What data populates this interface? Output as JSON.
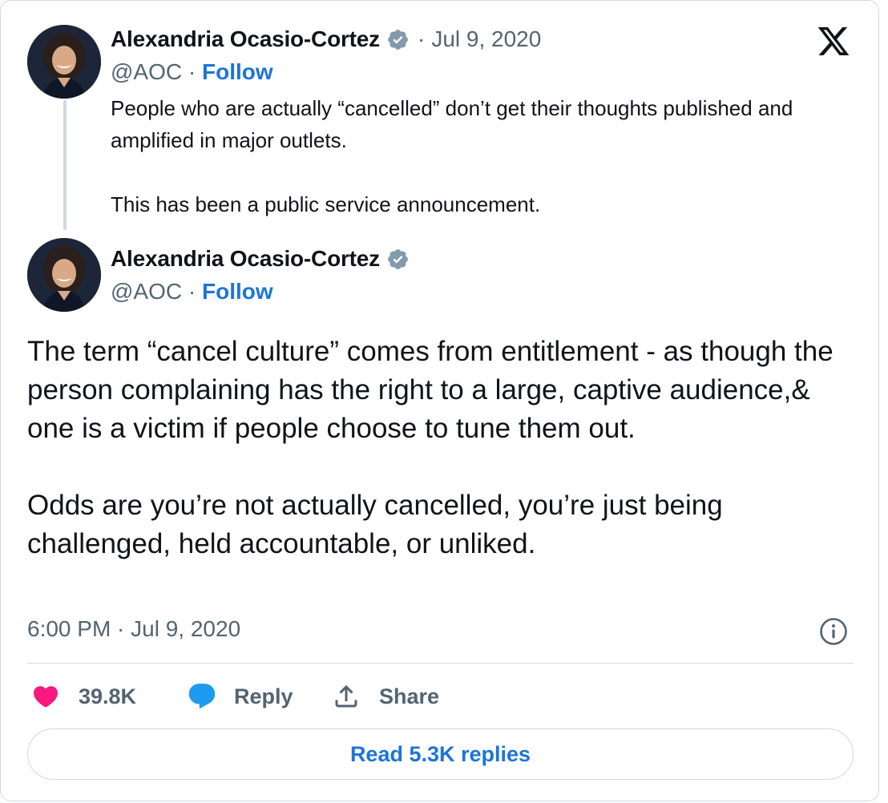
{
  "quoted_tweet": {
    "author_name": "Alexandria Ocasio-Cortez",
    "handle": "@AOC",
    "separator": "·",
    "follow_label": "Follow",
    "date_separator": "·",
    "date": "Jul 9, 2020",
    "text_paragraphs": [
      "People who are actually “cancelled” don’t get their thoughts published and amplified in major outlets.",
      "This has been a public service announcement."
    ]
  },
  "main_tweet": {
    "author_name": "Alexandria Ocasio-Cortez",
    "handle": "@AOC",
    "separator": "·",
    "follow_label": "Follow",
    "text_paragraphs": [
      "The term “cancel culture” comes from entitlement - as though the person complaining has the right to a large, captive audience,& one is a victim if people choose to tune them out.",
      "Odds are you’re not actually cancelled, you’re just being challenged, held accountable, or unliked."
    ],
    "timestamp": "6:00 PM · Jul 9, 2020"
  },
  "actions": {
    "like_count": "39.8K",
    "reply_label": "Reply",
    "share_label": "Share"
  },
  "read_replies_label": "Read 5.3K replies",
  "icons": {
    "logo": "x-logo-icon",
    "verified": "verified-badge-icon",
    "info": "info-icon",
    "like": "heart-icon",
    "reply": "speech-bubble-icon",
    "share": "share-upload-icon"
  },
  "colors": {
    "link_blue": "#1d74d8",
    "heart_pink": "#f91880",
    "reply_blue": "#1d9bf0",
    "verified_gray": "#829aab",
    "muted_text": "#536471",
    "border": "#cfd9de"
  }
}
